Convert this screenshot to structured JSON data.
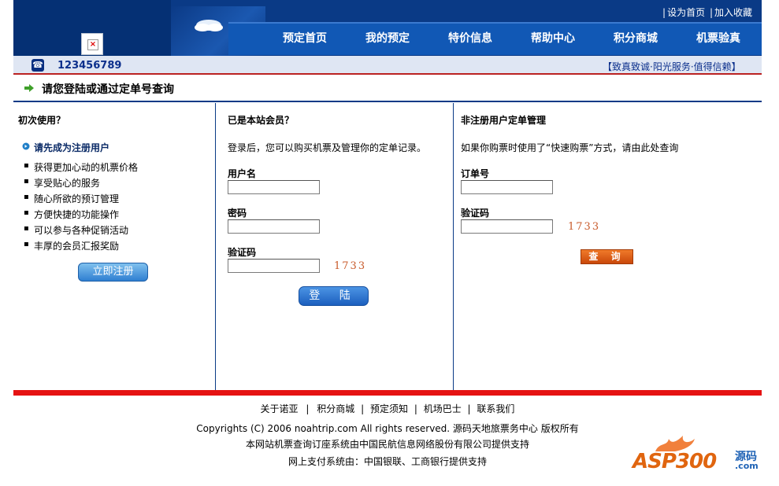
{
  "header": {
    "top_links": [
      "设为首页",
      "加入收藏"
    ],
    "nav": [
      "预定首页",
      "我的预定",
      "特价信息",
      "帮助中心",
      "积分商城",
      "机票验真"
    ],
    "phone": "123456789",
    "slogan": "【致真致诚·阳光服务·值得信赖】"
  },
  "prompt": "请您登陆或通过定单号查询",
  "col_new": {
    "title": "初次使用？",
    "subtitle": "请先成为注册用户",
    "items": [
      "获得更加心动的机票价格",
      "享受贴心的服务",
      "随心所欲的预订管理",
      "方便快捷的功能操作",
      "可以参与各种促销活动",
      "丰厚的会员汇报奖励"
    ],
    "register_label": "立即注册"
  },
  "col_member": {
    "title": "已是本站会员？",
    "desc": "登录后，您可以购买机票及管理你的定单记录。",
    "username_label": "用户名",
    "password_label": "密码",
    "captcha_label": "验证码",
    "captcha": "1733",
    "login_label": "登 陆"
  },
  "col_guest": {
    "title": "非注册用户定单管理",
    "desc": "如果你购票时使用了“快速购票”方式，请由此处查询",
    "order_label": "订单号",
    "captcha_label": "验证码",
    "captcha": "1733",
    "query_label": "查 询"
  },
  "footer": {
    "links": [
      "关于诺亚",
      "积分商城",
      "预定须知",
      "机场巴士",
      "联系我们"
    ],
    "copyright": "Copyrights (C) 2006 noahtrip.com All rights reserved. 源码天地旅票务中心 版权所有",
    "line2": "本网站机票查询订座系统由中国民航信息网络股份有限公司提供支持",
    "line3": "网上支付系统由：中国银联、工商银行提供支持"
  },
  "watermark": {
    "text": "ASP300",
    "cn": "源码",
    "domain": ".com"
  },
  "colors": {
    "header_blue": "#0a3a86",
    "nav_blue": "#1158b5",
    "red_bar": "#e51313",
    "captcha": "#c85a2a"
  }
}
